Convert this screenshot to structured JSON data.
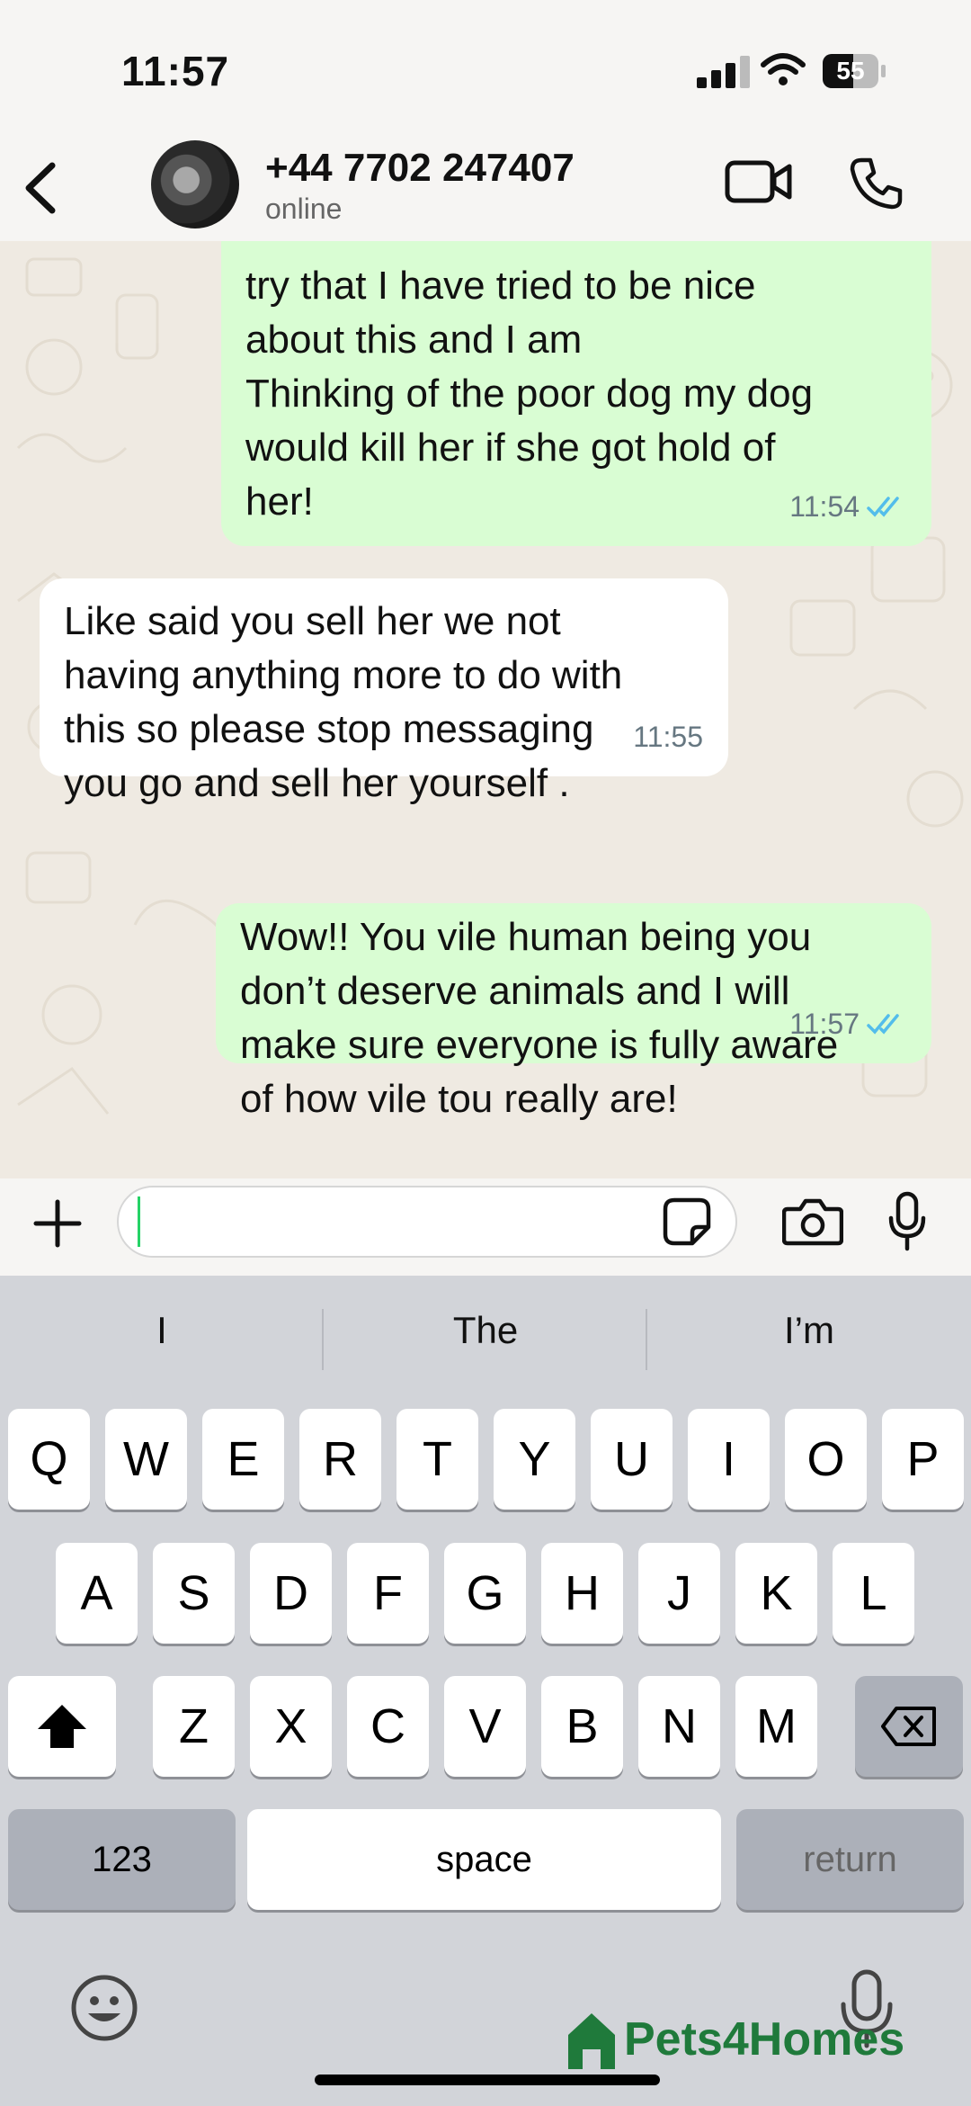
{
  "status_bar": {
    "time": "11:57",
    "battery": "55"
  },
  "header": {
    "contact_name": "+44 7702 247407",
    "status": "online"
  },
  "messages": [
    {
      "direction": "out",
      "text": "try that I have tried to be nice\nabout this and I am\nThinking of the poor dog my dog\nwould kill her if she got hold of\nher!",
      "time": "11:54",
      "read": true
    },
    {
      "direction": "in",
      "text": "Like said you sell her we not\nhaving anything more to do with\nthis so please stop messaging\nyou go and sell her yourself .",
      "time": "11:55"
    },
    {
      "direction": "out",
      "text": "Wow!! You vile human being you\ndon’t deserve animals and I will\nmake sure everyone is fully aware\nof how vile tou really are!",
      "time": "11:57",
      "read": true
    }
  ],
  "input": {
    "placeholder": ""
  },
  "keyboard": {
    "suggestions": [
      "I",
      "The",
      "I’m"
    ],
    "row1": [
      "Q",
      "W",
      "E",
      "R",
      "T",
      "Y",
      "U",
      "I",
      "O",
      "P"
    ],
    "row2": [
      "A",
      "S",
      "D",
      "F",
      "G",
      "H",
      "J",
      "K",
      "L"
    ],
    "row3": [
      "Z",
      "X",
      "C",
      "V",
      "B",
      "N",
      "M"
    ],
    "numbers_label": "123",
    "space_label": "space",
    "return_label": "return"
  },
  "watermark": "Pets4Homes",
  "colors": {
    "outgoing_bubble": "#d9fdd3",
    "incoming_bubble": "#ffffff",
    "read_ticks": "#53bdeb",
    "chat_bg": "#efeae2"
  }
}
